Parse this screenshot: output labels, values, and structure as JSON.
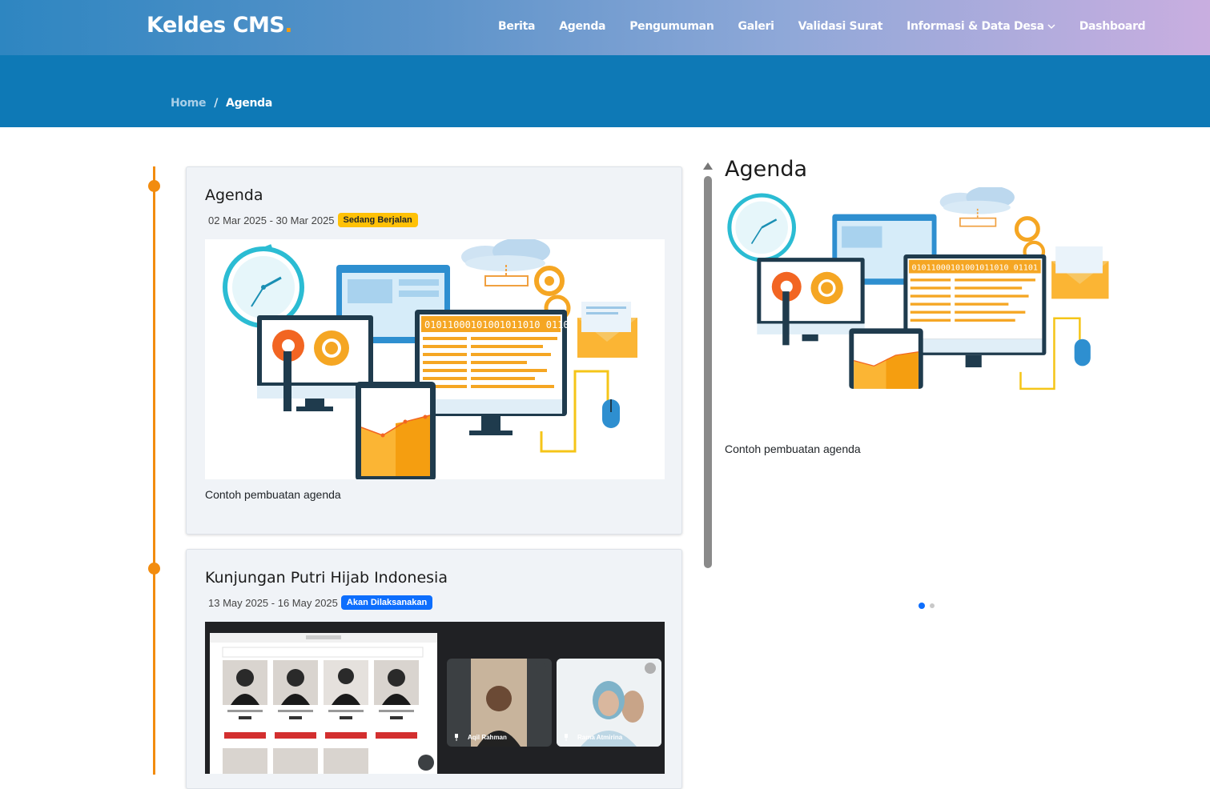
{
  "navbar": {
    "brand": "Keldes CMS",
    "brand_dot": ".",
    "menu": [
      {
        "label": "Berita"
      },
      {
        "label": "Agenda"
      },
      {
        "label": "Pengumuman"
      },
      {
        "label": "Galeri"
      },
      {
        "label": "Validasi Surat"
      },
      {
        "label": "Informasi & Data Desa",
        "icon": "chevron-down-icon"
      },
      {
        "label": "Dashboard"
      }
    ]
  },
  "breadcrumb": {
    "home": "Home",
    "separator": "/",
    "current": "Agenda"
  },
  "agenda_items": [
    {
      "title": "Agenda",
      "date_range": "02 Mar 2025 - 30 Mar 2025",
      "status": "Sedang Berjalan",
      "description": "Contoh pembuatan agenda"
    },
    {
      "title": "Kunjungan Putri Hijab Indonesia",
      "date_range": "13 May 2025 - 16 May 2025",
      "status": "Akan Dilaksanakan",
      "participants": [
        "Aqil Rahman",
        "Rama Atmirina"
      ]
    }
  ],
  "sidebar": {
    "title": "Agenda",
    "description": "Contoh pembuatan agenda",
    "carousel_active_index": 0
  },
  "illustration": {
    "binary_text": "01011000101001011010 01101"
  },
  "colors": {
    "accent_orange": "#f28c0f",
    "hero_blue": "#0e79b6",
    "badge_running": "#ffc107",
    "badge_upcoming": "#0d6efd"
  }
}
